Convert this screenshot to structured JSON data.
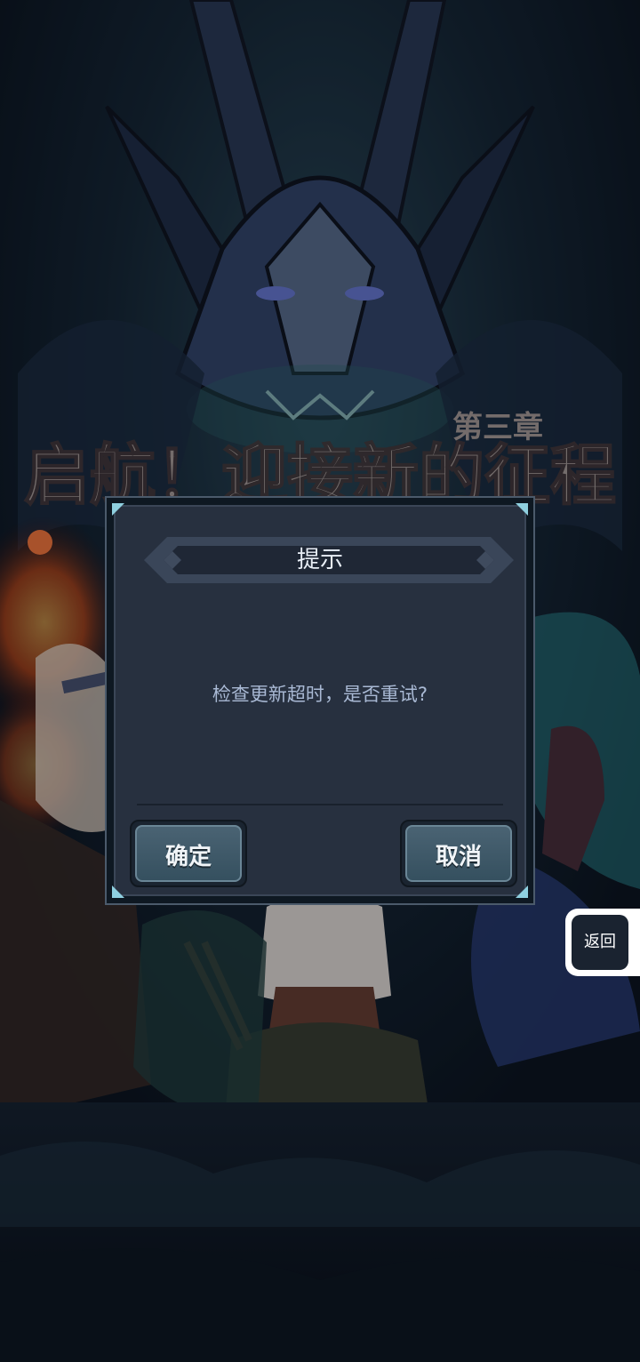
{
  "background": {
    "chapter_label": "第三章",
    "headline": "启航！迎接新的征程"
  },
  "dialog": {
    "title": "提示",
    "message": "检查更新超时，是否重试?",
    "confirm_label": "确定",
    "cancel_label": "取消"
  },
  "side": {
    "back_label": "返回"
  },
  "colors": {
    "dialog_bg": "#27303f",
    "button_face": "#3f5867",
    "message_text": "#a9b9d4",
    "title_text": "#e8eef6"
  }
}
